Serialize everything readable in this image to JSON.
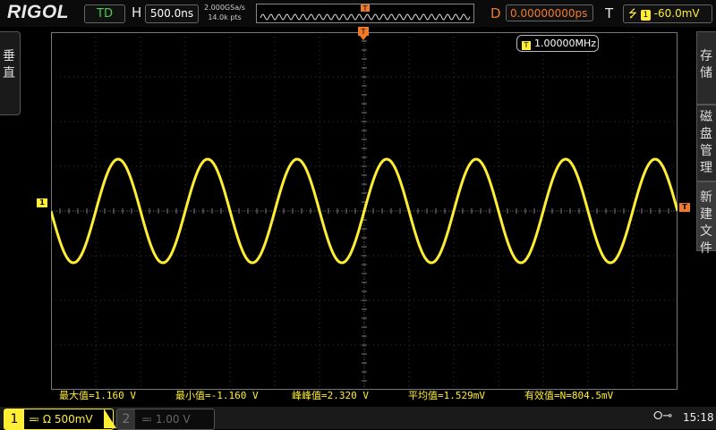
{
  "header": {
    "brand": "RIGOL",
    "trigger_mode": "TD",
    "horizontal_label": "H",
    "timebase": "500.0ns",
    "sample_rate": "2.000GSa/s",
    "memory_depth": "14.0k pts",
    "delay_label": "D",
    "delay": "0.00000000ps",
    "trigger_label": "T",
    "trigger_source": "1",
    "trigger_level": "-60.0mV"
  },
  "left_menu": {
    "label": "垂直"
  },
  "right_menu": {
    "items": [
      {
        "label": "存储"
      },
      {
        "label": "磁盘管理"
      },
      {
        "label": "新建文件"
      }
    ]
  },
  "display": {
    "channel_marker": "1",
    "trigger_marker": "T",
    "frequency_counter": "1.00000MHz",
    "frequency_tag": "T"
  },
  "measurements": [
    {
      "text": "最大值=1.160 V"
    },
    {
      "text": "最小值=-1.160 V"
    },
    {
      "text": "峰峰值=2.320 V"
    },
    {
      "text": "平均值=1.529mV"
    },
    {
      "text": "有效值=N=804.5mV"
    }
  ],
  "footer": {
    "ch1_number": "1",
    "ch1_coupling": "Ω",
    "ch1_scale": "500mV",
    "ch2_number": "2",
    "ch2_scale": "1.00 V",
    "time": "15:18"
  },
  "waveform": {
    "cycles_on_screen": 7,
    "amplitude_divisions": 2.32,
    "color": "#ffee33"
  },
  "colors": {
    "channel1": "#ffee33",
    "trigger": "#f07a2a",
    "status_ok": "#4ad04a"
  }
}
